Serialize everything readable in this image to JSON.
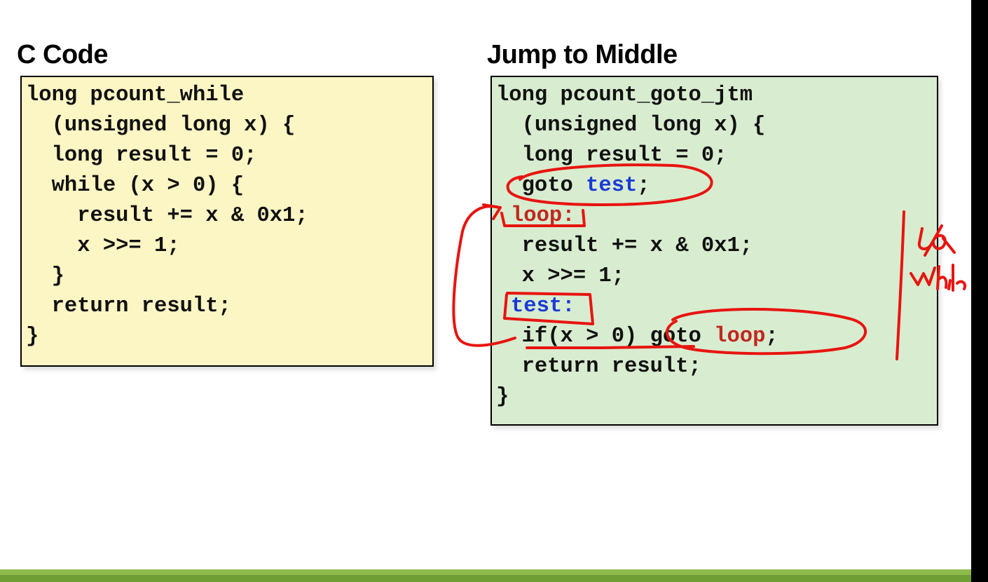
{
  "left_panel": {
    "heading": "C Code",
    "lines": [
      "long pcount_while",
      "  (unsigned long x) {",
      "  long result = 0;",
      "  while (x > 0) {",
      "    result += x & 0x1;",
      "    x >>= 1;",
      "  }",
      "  return result;",
      "}"
    ]
  },
  "right_panel": {
    "heading": "Jump to Middle",
    "lines": [
      "long pcount_goto_jtm",
      "  (unsigned long x) {",
      "  long result = 0;"
    ],
    "goto_line": {
      "prefix": "  goto ",
      "target": "test",
      "suffix": ";"
    },
    "loop_label": "loop:",
    "body_lines": [
      "  result += x & 0x1;",
      "  x >>= 1;"
    ],
    "test_label": "test:",
    "if_line": {
      "prefix": "  if(x > 0) goto ",
      "target": "loop",
      "suffix": ";"
    },
    "tail_lines": [
      "  return result;",
      "}"
    ]
  },
  "colors": {
    "left_box_bg": "#fcf5c4",
    "right_box_bg": "#d8ecd0",
    "label_red": "#c0281e",
    "label_blue": "#1a3ad6",
    "ink_red": "#e8140f",
    "bottom_bar_green": "#7fae3f"
  }
}
